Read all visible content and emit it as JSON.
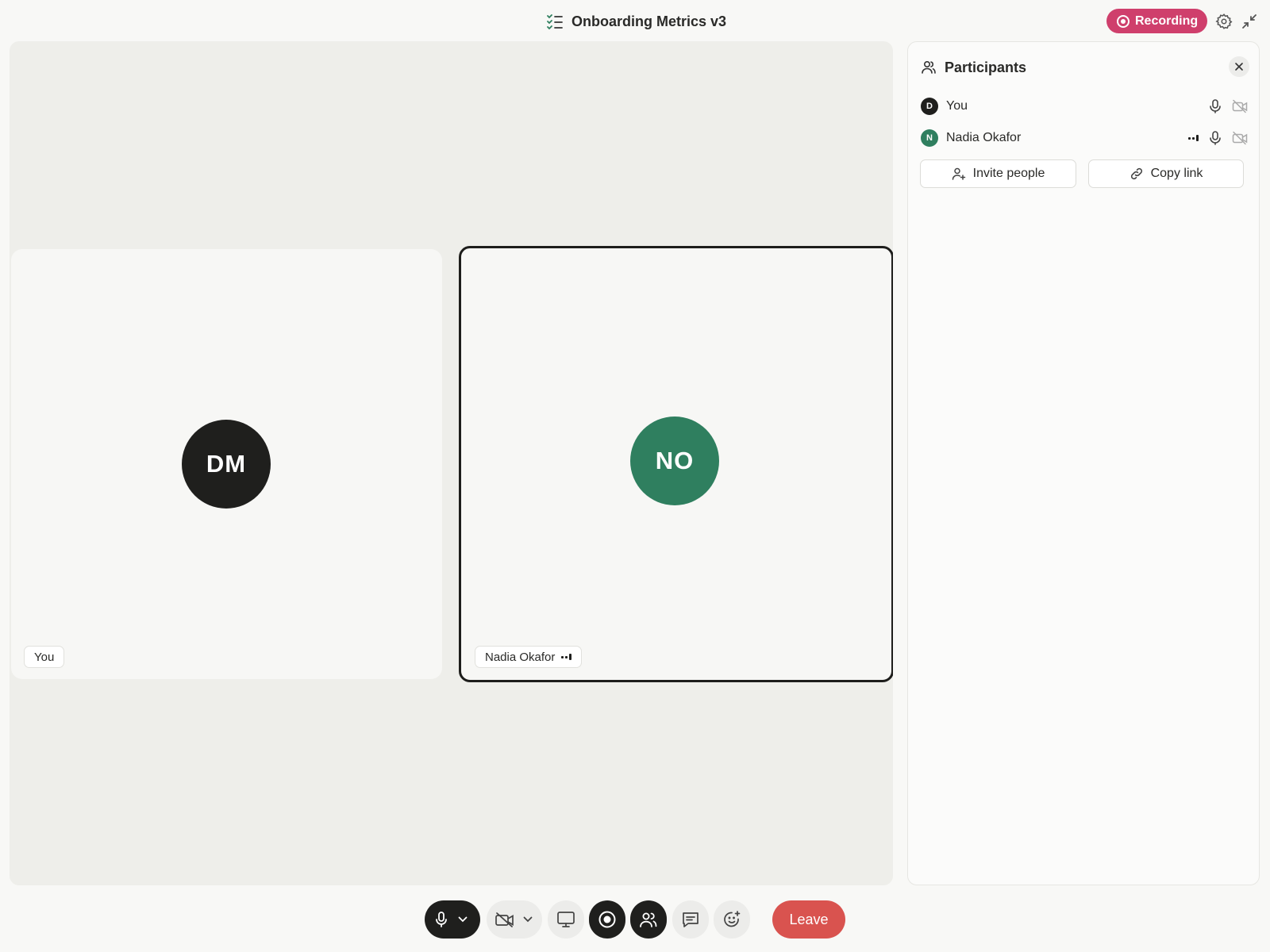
{
  "meeting": {
    "title": "Onboarding Metrics v3",
    "recording_label": "Recording"
  },
  "colors": {
    "recording": "#cf3f6c",
    "leave": "#d9534f",
    "nadia_avatar": "#2f7f5f",
    "you_avatar": "#1f1f1d"
  },
  "tiles": [
    {
      "initials": "DM",
      "name_tag": "You",
      "speaking": false
    },
    {
      "initials": "NO",
      "name_tag": "Nadia Okafor",
      "speaking": true
    }
  ],
  "panel": {
    "title": "Participants",
    "participants": [
      {
        "initial": "D",
        "name": "You",
        "mic_icon": "mic-icon",
        "camera_icon": "camera-off-icon"
      },
      {
        "initial": "N",
        "name": "Nadia Okafor",
        "signal_icon": "audio-level-icon",
        "mic_icon": "mic-icon",
        "camera_icon": "camera-off-icon"
      }
    ],
    "invite_label": "Invite people",
    "copy_link_label": "Copy link"
  },
  "controls": {
    "leave_label": "Leave",
    "icons": [
      "mic-icon",
      "chevron-down-icon",
      "camera-off-icon",
      "chevron-down-icon",
      "screen-share-icon",
      "record-icon",
      "participants-icon",
      "chat-icon",
      "reaction-icon"
    ]
  }
}
